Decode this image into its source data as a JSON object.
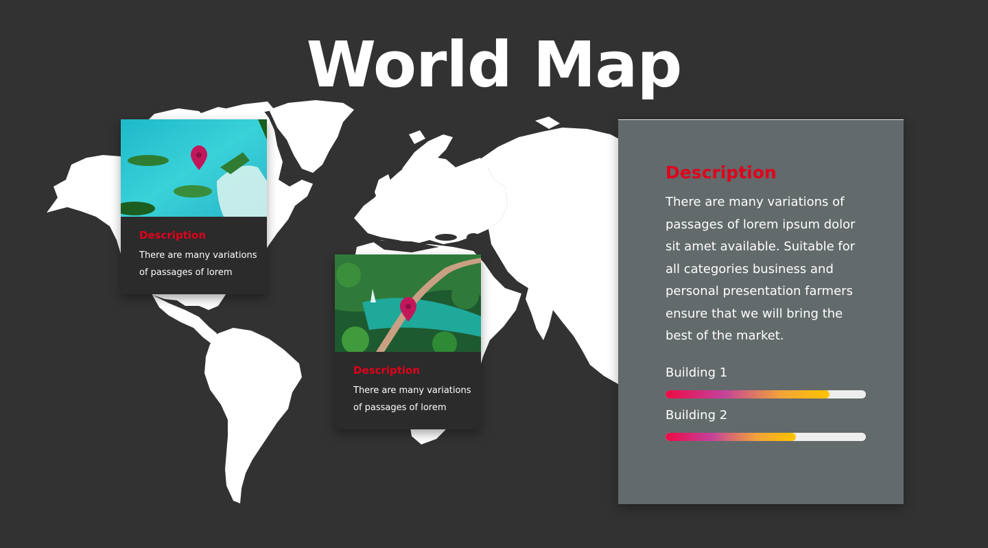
{
  "title": "World Map",
  "colors": {
    "background": "#323232",
    "map": "#ffffff",
    "accent_red": "#e0001b",
    "panel": "#636a6c",
    "pin": "#c2185b",
    "bar_gradient": [
      "#ee0a45",
      "#c4419b",
      "#f2a33a",
      "#ffc400"
    ]
  },
  "cards": [
    {
      "title": "Description",
      "text": "There are many variations of passages of lorem",
      "image": "aerial-islands-photo"
    },
    {
      "title": "Description",
      "text": "There are many variations of passages of lorem",
      "image": "forest-boardwalk-photo"
    }
  ],
  "panel": {
    "title": "Description",
    "text": "There are many variations of passages of lorem ipsum dolor sit amet available. Suitable for all categories business and personal presentation farmers ensure that we will bring the best of the market.",
    "bars": [
      {
        "label": "Building 1",
        "value": 0.82
      },
      {
        "label": "Building 2",
        "value": 0.65
      }
    ]
  }
}
